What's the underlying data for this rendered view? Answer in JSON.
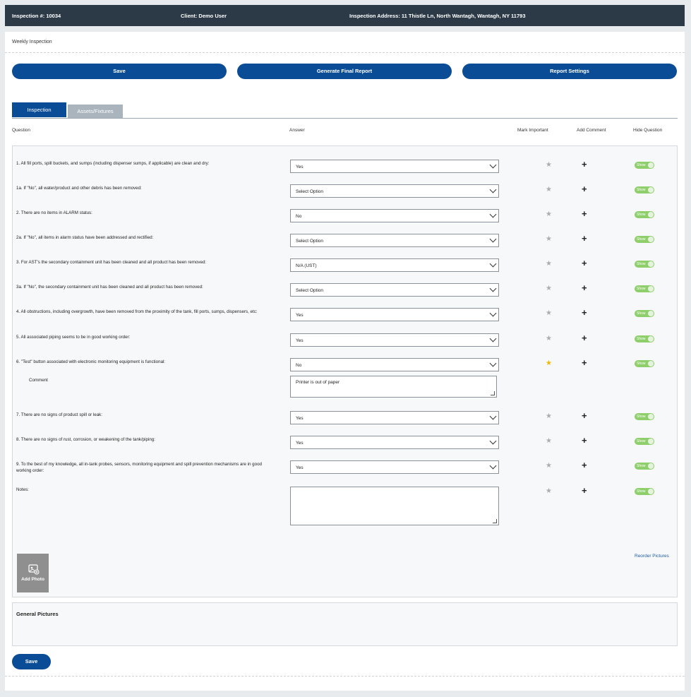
{
  "header": {
    "inspection": "Inspection #: 10034",
    "client": "Client: Demo User",
    "address": "Inspection Address: 11 Thistle Ln, North Wantagh, Wantagh, NY 11793"
  },
  "page": {
    "subtitle": "Weekly Inspection",
    "save_label": "Save",
    "generate_label": "Generate Final Report",
    "settings_label": "Report Settings",
    "tabs": [
      "Inspection",
      "Assets/Fixtures"
    ],
    "columns": {
      "question": "Question",
      "answer": "Answer",
      "mark": "Mark Important",
      "comment": "Add Comment",
      "hide": "Hide Question"
    },
    "toggle_label": "Show",
    "comment_label": "Comment",
    "comment_value": "Printer is out of paper",
    "notes_label": "Notes:",
    "add_photo": "Add Photo",
    "reorder": "Reorder Pictures",
    "general_pictures": "General Pictures",
    "bottom_save": "Save"
  },
  "questions": [
    {
      "text": "1. All fill ports, spill buckets, and sumps (including dispenser sumps, if applicable) are clean and dry:",
      "answer": "Yes",
      "important": false
    },
    {
      "text": "1a. If \"No\", all water/product and other debris has been removed:",
      "answer": "Select Option",
      "important": false
    },
    {
      "text": "2. There are no items in ALARM status:",
      "answer": "No",
      "important": false
    },
    {
      "text": "2a. If \"No\", all items in alarm status have been addressed and rectified:",
      "answer": "Select Option",
      "important": false
    },
    {
      "text": "3. For AST's the secondary containment unit has been cleaned and all product has been removed:",
      "answer": "N/A (UST)",
      "important": false
    },
    {
      "text": "3a. If \"No\", the secondary containment unit has been cleaned and all product has been removed:",
      "answer": "Select Option",
      "important": false
    },
    {
      "text": "4. All obstructions, including overgrowth, have been removed from the proximity of the tank, fill ports, sumps, dispensers, etc:",
      "answer": "Yes",
      "important": false
    },
    {
      "text": "5. All associated piping seems to be in good working order:",
      "answer": "Yes",
      "important": false
    },
    {
      "text": "6. \"Test\" button associated with electronic monitoring equipment is functional:",
      "answer": "No",
      "important": true
    },
    {
      "text": "7. There are no signs of product spill or leak:",
      "answer": "Yes",
      "important": false
    },
    {
      "text": "8. There are no signs of rust, corrosion, or weakening of the tank/piping:",
      "answer": "Yes",
      "important": false
    },
    {
      "text": "9. To the best of my knowledge, all in-tank probes, sensors, monitoring equipment and spill prevention mechanisms are in good working order:",
      "answer": "Yes",
      "important": false
    }
  ],
  "icons": {
    "star": "star-icon",
    "plus": "plus-icon",
    "chevron": "chevron-down-icon",
    "camera": "add-photo-icon"
  },
  "colors": {
    "primary": "#0a4d96",
    "header": "#2c3a48",
    "toggle": "#8fcf6b",
    "star_active": "#f2b705"
  }
}
